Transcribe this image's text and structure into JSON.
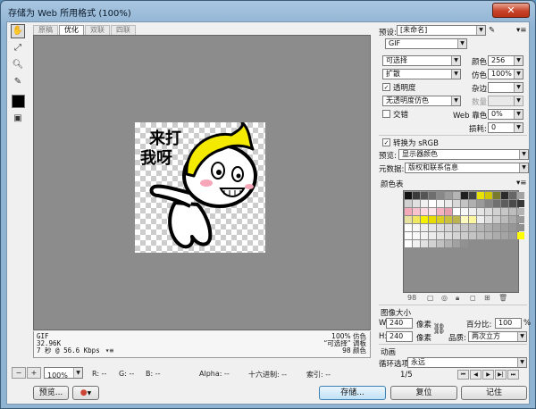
{
  "window": {
    "title": "存储为 Web 所用格式 (100%)",
    "close": "✕"
  },
  "tabs": [
    "原稿",
    "优化",
    "双联",
    "四联"
  ],
  "image": {
    "line1": "来打",
    "line2": "我呀"
  },
  "info": {
    "format": "GIF",
    "size": "32.96K",
    "time": "7 秒 @ 56.6 Kbps",
    "dither": "100% 仿色",
    "palette": "“可选择” 调板",
    "colors": "98 颜色"
  },
  "status": {
    "zoom": "100%",
    "r": "R: --",
    "g": "G: --",
    "b": "B: --",
    "alpha": "Alpha: --",
    "hex": "十六进制: --",
    "index": "索引: --"
  },
  "buttons": {
    "preview": "预览...",
    "save": "存储...",
    "reset": "复位",
    "remember": "记住"
  },
  "settings": {
    "preset_label": "预设:",
    "preset_value": "[未命名]",
    "format": "GIF",
    "reduction": "可选择",
    "colors_label": "颜色:",
    "colors_value": "256",
    "dither_algo": "扩散",
    "dither_label": "仿色:",
    "dither_value": "100%",
    "transparency": "透明度",
    "matte_label": "杂边:",
    "transparency_dither": "无透明度仿色",
    "amount_label": "数量:",
    "interlaced": "交错",
    "web_snap_label": "Web 靠色:",
    "web_snap_value": "0%",
    "lossy_label": "损耗:",
    "lossy_value": "0",
    "convert_srgb": "转换为 sRGB",
    "preview_label": "预览:",
    "preview_value": "显示器颜色",
    "metadata_label": "元数据:",
    "metadata_value": "版权和联系信息",
    "color_table": "颜色表",
    "color_count": "98"
  },
  "image_size": {
    "title": "图像大小",
    "w_label": "W:",
    "w": "240",
    "h_label": "H:",
    "h": "240",
    "unit": "像素",
    "percent_label": "百分比:",
    "percent": "100",
    "percent_unit": "%",
    "quality_label": "品质:",
    "quality": "两次立方"
  },
  "animation": {
    "title": "动画",
    "loop_label": "循环选项:",
    "loop": "永远",
    "frame": "1/5"
  },
  "palette_colors": [
    "#111111",
    "#3a3a3a",
    "#555555",
    "#6e6e6e",
    "#888888",
    "#9c9c9c",
    "#b5b5b5",
    "#1f1f1f",
    "#444444",
    "#e9e200",
    "#cfc500",
    "#7a7a2e",
    "#2b2b2b",
    "#666666",
    "#a3a3a3",
    "#d0d0d0",
    "#e0e0e0",
    "#f0f0f0",
    "#ffffff",
    "#f5f5f5",
    "#eaeaea",
    "#d8d8d8",
    "#c4c4c4",
    "#b0b0b0",
    "#9a9a9a",
    "#858585",
    "#707070",
    "#5d5d5d",
    "#4b4b4b",
    "#393939",
    "#f4a9b8",
    "#f7c3cc",
    "#ffd9df",
    "#fbe6ea",
    "#f3b3c0",
    "#e9a0ae",
    "#ffffff",
    "#f8f8f8",
    "#efefef",
    "#e5e5e5",
    "#dbdbdb",
    "#d1d1d1",
    "#c7c7c7",
    "#bdbdbd",
    "#b3b3b3",
    "#e8e2a0",
    "#f0e860",
    "#f5ef00",
    "#e6dc00",
    "#d8cf22",
    "#c9c040",
    "#bbb250",
    "#fffbc0",
    "#fff7a0",
    "#eeeeee",
    "#dddddd",
    "#cccccc",
    "#bbbbbb",
    "#aaaaaa",
    "#999999",
    "#ffffff",
    "#f7f7f7",
    "#eeeeee",
    "#e6e6e6",
    "#dedede",
    "#d6d6d6",
    "#cecece",
    "#c6c6c6",
    "#bebebe",
    "#b6b6b6",
    "#aeaeae",
    "#a6a6a6",
    "#9e9e9e",
    "#969696",
    "#8e8e8e",
    "#ffffff",
    "#fafafa",
    "#f3f3f3",
    "#ececec",
    "#e4e4e4",
    "#dcdcdc",
    "#d4d4d4",
    "#cccccc",
    "#c4c4c4",
    "#bcbcbc",
    "#b4b4b4",
    "#acacac",
    "#a4a4a4",
    "#9c9c9c",
    "#ffff00",
    "#ffffff",
    "#f1f1f1",
    "#e1e1e1",
    "#d1d1d1",
    "#c1c1c1",
    "#b1b1b1",
    "#a1a1a1",
    "#919191"
  ]
}
